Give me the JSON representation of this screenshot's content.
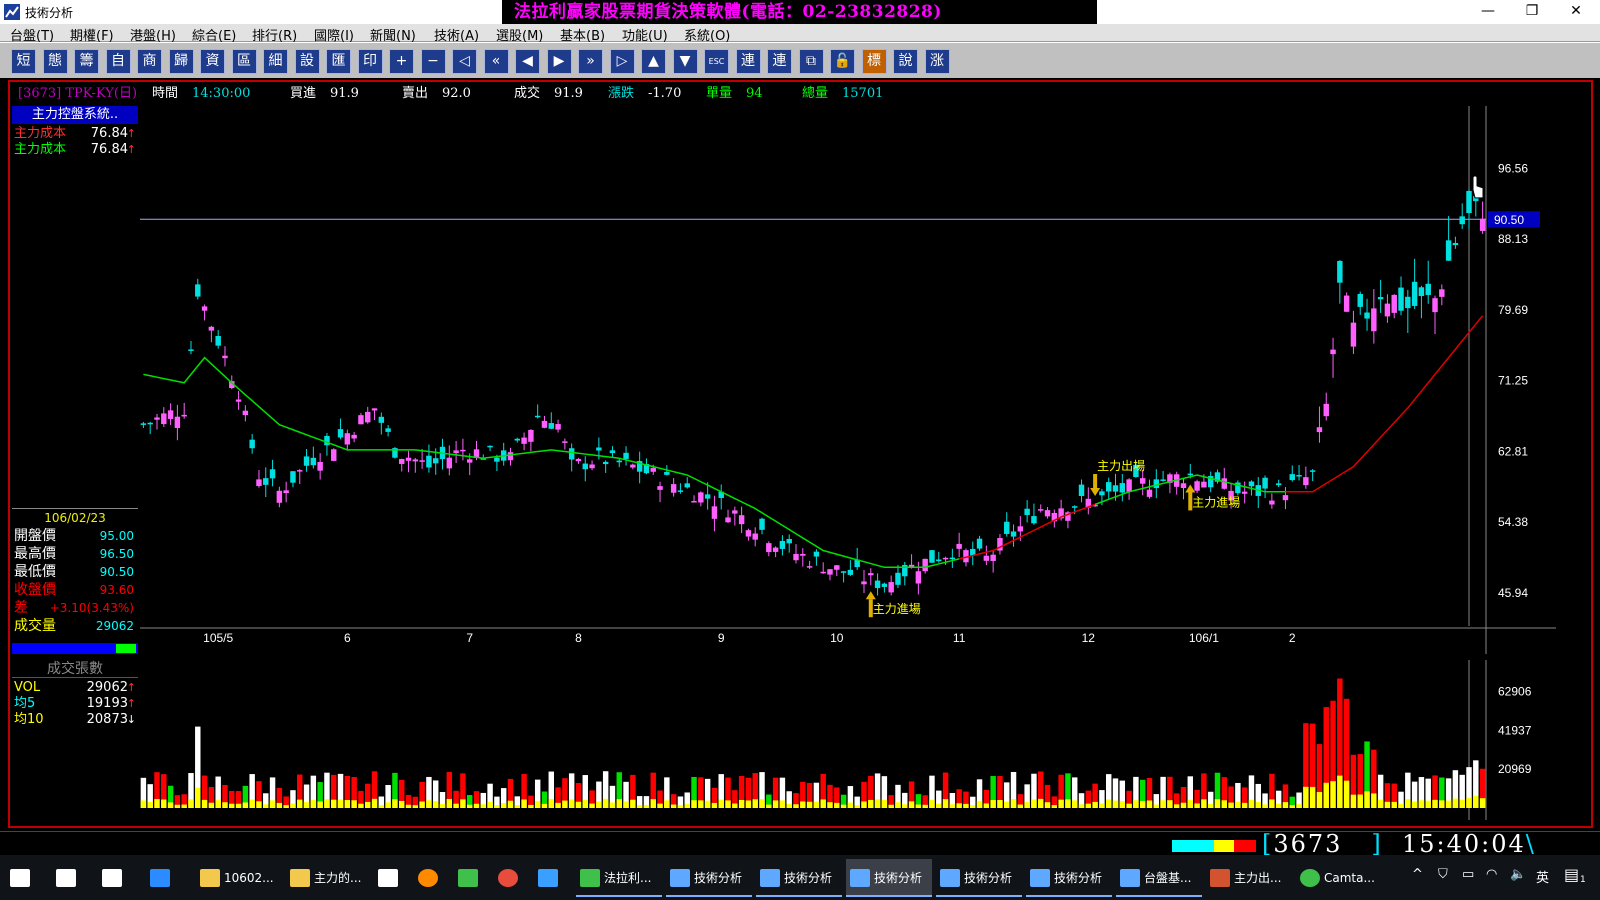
{
  "window": {
    "title": "技術分析",
    "banner": "法拉利贏家股票期貨決策軟體(電話：02-23832828)"
  },
  "menu": [
    "台盤(T)",
    "期權(F)",
    "港盤(H)",
    "綜合(E)",
    "排行(R)",
    "國際(I)",
    "新聞(N)",
    "技術(A)",
    "選股(M)",
    "基本(B)",
    "功能(U)",
    "系統(O)"
  ],
  "toolbar": [
    {
      "label": "短",
      "icon": "short-term-icon"
    },
    {
      "label": "態",
      "icon": "pattern-icon"
    },
    {
      "label": "籌",
      "icon": "chips-icon"
    },
    {
      "label": "自",
      "icon": "custom-icon"
    },
    {
      "label": "商",
      "icon": "commodity-icon"
    },
    {
      "label": "歸",
      "icon": "category-icon"
    },
    {
      "label": "資",
      "icon": "data-icon"
    },
    {
      "label": "區",
      "icon": "zone-icon"
    },
    {
      "label": "細",
      "icon": "detail-icon"
    },
    {
      "label": "設",
      "icon": "settings-icon"
    },
    {
      "label": "匯",
      "icon": "export-icon"
    },
    {
      "label": "印",
      "icon": "print-icon"
    },
    {
      "label": "+",
      "icon": "zoom-in-icon"
    },
    {
      "label": "−",
      "icon": "zoom-out-icon"
    },
    {
      "label": "◁",
      "icon": "back-icon"
    },
    {
      "label": "«",
      "icon": "rewind-icon"
    },
    {
      "label": "◀",
      "icon": "prev-icon"
    },
    {
      "label": "▶",
      "icon": "next-icon"
    },
    {
      "label": "»",
      "icon": "forward-icon"
    },
    {
      "label": "▷",
      "icon": "end-icon"
    },
    {
      "label": "▲",
      "icon": "up-icon"
    },
    {
      "label": "▼",
      "icon": "down-icon"
    },
    {
      "label": "ESC",
      "icon": "escape-icon"
    },
    {
      "label": "連",
      "icon": "link-icon"
    },
    {
      "label": "連",
      "icon": "link2-icon"
    },
    {
      "label": "⧉",
      "icon": "window-icon"
    },
    {
      "label": "🔓",
      "icon": "unlock-icon"
    },
    {
      "label": "標",
      "icon": "mark-icon"
    },
    {
      "label": "說",
      "icon": "help-icon"
    },
    {
      "label": "涨",
      "icon": "rise-icon"
    }
  ],
  "quote": {
    "code": "[3673] TPK-KY(日)",
    "time_label": "時間",
    "time": "14:30:00",
    "bid_label": "買進",
    "bid": "91.9",
    "ask_label": "賣出",
    "ask": "92.0",
    "last_label": "成交",
    "last": "91.9",
    "change_label": "漲跌",
    "change": "-1.70",
    "qty_label": "單量",
    "qty": "94",
    "total_label": "總量",
    "total": "15701"
  },
  "side": {
    "title": "主力控盤系統..",
    "rows": [
      {
        "label": "主力成本",
        "value": "76.84",
        "color": "#ff3030"
      },
      {
        "label": "主力成本",
        "value": "76.84",
        "color": "#00ff00"
      }
    ],
    "date": "106/02/23",
    "ohlc": [
      {
        "label": "開盤價",
        "value": "95.00",
        "color": "#00ffff",
        "lcolor": "#ffffff"
      },
      {
        "label": "最高價",
        "value": "96.50",
        "color": "#00ffff",
        "lcolor": "#ffffff"
      },
      {
        "label": "最低價",
        "value": "90.50",
        "color": "#00ffff",
        "lcolor": "#ffffff"
      },
      {
        "label": "收盤價",
        "value": "93.60",
        "color": "#ff0000",
        "lcolor": "#ff0000"
      },
      {
        "label": "差",
        "value": "+3.10(3.43%)",
        "color": "#ff0000",
        "lcolor": "#ff0000"
      },
      {
        "label": "成交量",
        "value": "29062",
        "color": "#00ffff",
        "lcolor": "#ffff00"
      }
    ]
  },
  "volume_panel": {
    "title": "成交張數",
    "rows": [
      {
        "label": "VOL",
        "value": "29062",
        "arrow": "↑",
        "color": "#ffff00",
        "acolor": "#ff3030"
      },
      {
        "label": "均5",
        "value": "19193",
        "arrow": "↑",
        "color": "#00ffff",
        "acolor": "#ff3030"
      },
      {
        "label": "均10",
        "value": "20873",
        "arrow": "↓",
        "color": "#ffff00",
        "acolor": "#ffffff"
      }
    ]
  },
  "annotations": [
    {
      "text": "主力進場",
      "dir": "up",
      "bar": 107
    },
    {
      "text": "主力出場",
      "dir": "down",
      "bar": 140
    },
    {
      "text": "主力進場",
      "dir": "up",
      "bar": 154
    }
  ],
  "status": {
    "code": "3673",
    "time": "15:40:04"
  },
  "taskbar": [
    {
      "label": "",
      "icon": "windows-start-icon"
    },
    {
      "label": "",
      "icon": "search-icon"
    },
    {
      "label": "",
      "icon": "task-view-icon"
    },
    {
      "label": "",
      "icon": "edge-icon"
    },
    {
      "label": "10602...",
      "icon": "folder-icon"
    },
    {
      "label": "主力的...",
      "icon": "folder-icon"
    },
    {
      "label": "",
      "icon": "store-icon"
    },
    {
      "label": "",
      "icon": "firefox-icon"
    },
    {
      "label": "",
      "icon": "app-icon"
    },
    {
      "label": "",
      "icon": "chrome-icon"
    },
    {
      "label": "",
      "icon": "ie-icon"
    },
    {
      "label": "法拉利...",
      "icon": "app-icon"
    },
    {
      "label": "技術分析",
      "icon": "chart-icon"
    },
    {
      "label": "技術分析",
      "icon": "chart-icon"
    },
    {
      "label": "技術分析",
      "icon": "chart-icon"
    },
    {
      "label": "技術分析",
      "icon": "chart-icon"
    },
    {
      "label": "技術分析",
      "icon": "chart-icon"
    },
    {
      "label": "台盤基...",
      "icon": "chart-icon"
    },
    {
      "label": "主力出...",
      "icon": "powerpoint-icon"
    },
    {
      "label": "Camta...",
      "icon": "camtasia-icon"
    }
  ],
  "tray": {
    "lang": "英",
    "notify_count": "1"
  },
  "chart_data": {
    "type": "candlestick",
    "title": "",
    "price_axis_ticks": [
      96.56,
      88.13,
      79.69,
      71.25,
      62.81,
      54.38,
      45.94
    ],
    "ylim": [
      42,
      104
    ],
    "current_price_line": 90.5,
    "x_ticks": [
      {
        "label": "105/5",
        "bar": 11
      },
      {
        "label": "6",
        "bar": 30
      },
      {
        "label": "7",
        "bar": 48
      },
      {
        "label": "8",
        "bar": 64
      },
      {
        "label": "9",
        "bar": 85
      },
      {
        "label": "10",
        "bar": 102
      },
      {
        "label": "11",
        "bar": 120
      },
      {
        "label": "12",
        "bar": 139
      },
      {
        "label": "106/1",
        "bar": 156
      },
      {
        "label": "2",
        "bar": 169
      }
    ],
    "anchors": [
      [
        0,
        66
      ],
      [
        6,
        68
      ],
      [
        8,
        82
      ],
      [
        11,
        76
      ],
      [
        14,
        70
      ],
      [
        17,
        60
      ],
      [
        20,
        58
      ],
      [
        25,
        62
      ],
      [
        30,
        65
      ],
      [
        34,
        68
      ],
      [
        37,
        63
      ],
      [
        42,
        61
      ],
      [
        47,
        63
      ],
      [
        54,
        62
      ],
      [
        58,
        67
      ],
      [
        61,
        66
      ],
      [
        63,
        61
      ],
      [
        67,
        62
      ],
      [
        72,
        61
      ],
      [
        78,
        59
      ],
      [
        84,
        57
      ],
      [
        90,
        54
      ],
      [
        95,
        51
      ],
      [
        101,
        49
      ],
      [
        109,
        47
      ],
      [
        113,
        49
      ],
      [
        119,
        51
      ],
      [
        124,
        50
      ],
      [
        132,
        56
      ],
      [
        140,
        57
      ],
      [
        147,
        59
      ],
      [
        154,
        60
      ],
      [
        161,
        58
      ],
      [
        167,
        58
      ],
      [
        172,
        60
      ],
      [
        174,
        68
      ],
      [
        176,
        82
      ],
      [
        178,
        77
      ],
      [
        182,
        82
      ],
      [
        186,
        80
      ],
      [
        190,
        81
      ],
      [
        194,
        90
      ],
      [
        197,
        92
      ]
    ],
    "ma_line": [
      [
        0,
        72
      ],
      [
        6,
        71
      ],
      [
        9,
        74
      ],
      [
        13,
        71
      ],
      [
        20,
        66
      ],
      [
        30,
        63
      ],
      [
        40,
        63
      ],
      [
        50,
        62
      ],
      [
        60,
        63
      ],
      [
        70,
        62
      ],
      [
        80,
        60
      ],
      [
        90,
        56
      ],
      [
        100,
        51
      ],
      [
        109,
        49
      ],
      [
        115,
        49
      ],
      [
        125,
        51
      ],
      [
        135,
        55
      ],
      [
        145,
        58
      ],
      [
        155,
        60
      ],
      [
        165,
        58
      ],
      [
        172,
        58
      ],
      [
        178,
        61
      ],
      [
        186,
        68
      ],
      [
        197,
        79
      ]
    ],
    "volume_ticks": [
      62906,
      41937,
      20969
    ],
    "volume_ylim": [
      0,
      80000
    ]
  }
}
